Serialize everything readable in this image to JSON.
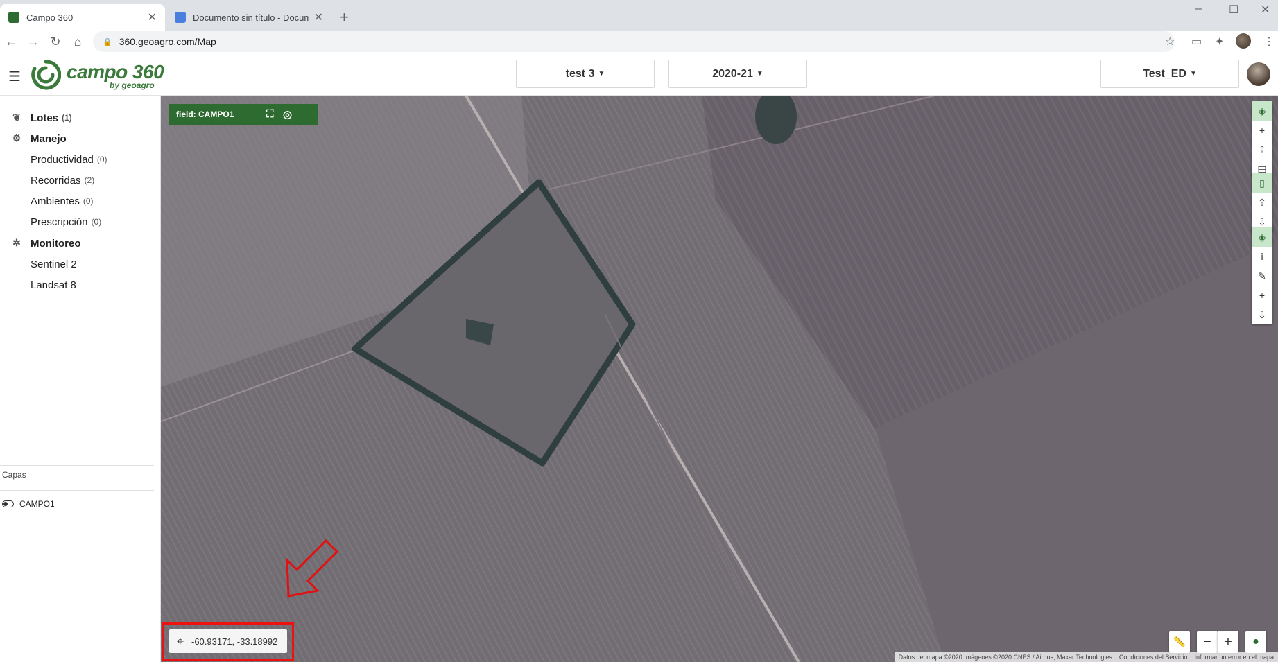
{
  "browser": {
    "tabs": [
      {
        "title": "Campo 360",
        "active": true
      },
      {
        "title": "Documento sin título - Documen",
        "active": false
      }
    ],
    "url": "360.geoagro.com/Map"
  },
  "app": {
    "logo_text": "campo 360",
    "logo_sub": "by geoagro",
    "project_dropdown": "test 3",
    "season_dropdown": "2020-21",
    "user_dropdown": "Test_ED"
  },
  "sidebar": {
    "lotes": {
      "label": "Lotes",
      "count": "(1)"
    },
    "manejo": {
      "label": "Manejo"
    },
    "manejo_items": [
      {
        "label": "Productividad",
        "count": "(0)"
      },
      {
        "label": "Recorridas",
        "count": "(2)"
      },
      {
        "label": "Ambientes",
        "count": "(0)"
      },
      {
        "label": "Prescripción",
        "count": "(0)"
      }
    ],
    "monitoreo": {
      "label": "Monitoreo"
    },
    "monitoreo_items": [
      {
        "label": "Sentinel 2"
      },
      {
        "label": "Landsat 8"
      }
    ],
    "capas_label": "Capas",
    "layers": [
      {
        "label": "CAMPO1",
        "enabled": true
      }
    ]
  },
  "map": {
    "field_badge": "field: CAMPO1",
    "coordinates": "-60.93171, -33.18992",
    "attribution": [
      "Datos del mapa ©2020 Imágenes ©2020 CNES / Airbus, Maxar Technologies",
      "Condiciones del Servicio",
      "Informar un error en el mapa"
    ]
  },
  "colors": {
    "brand_green": "#2e6b30",
    "highlight_red": "#e11111"
  },
  "icons": {
    "lotes": "sprout-icon",
    "manejo": "tractor-icon",
    "monitoreo": "satellite-icon",
    "coordinates": "crosshair-icon"
  }
}
